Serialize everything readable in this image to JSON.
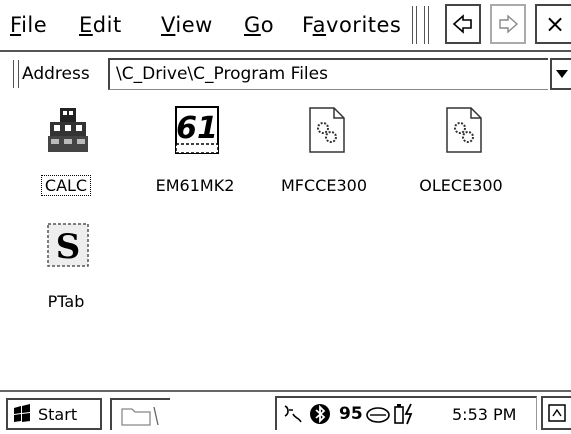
{
  "menubar": {
    "items": [
      {
        "label_pre": "",
        "label_u": "F",
        "label_post": "ile"
      },
      {
        "label_pre": "",
        "label_u": "E",
        "label_post": "dit"
      },
      {
        "label_pre": "",
        "label_u": "V",
        "label_post": "iew"
      },
      {
        "label_pre": "",
        "label_u": "G",
        "label_post": "o"
      },
      {
        "label_pre": "F",
        "label_u": "a",
        "label_post": "vorites"
      }
    ],
    "back_icon": "back-arrow-icon",
    "forward_icon": "forward-arrow-icon",
    "close_label": "×"
  },
  "address": {
    "label": "Address",
    "value": "\\C_Drive\\C_Program Files"
  },
  "files": [
    {
      "name": "CALC",
      "icon": "calc-app-icon",
      "selected": true
    },
    {
      "name": "EM61MK2",
      "icon": "em61-app-icon",
      "selected": false
    },
    {
      "name": "MFCCE300",
      "icon": "dll-gears-icon",
      "selected": false
    },
    {
      "name": "OLECE300",
      "icon": "dll-gears-icon",
      "selected": false
    },
    {
      "name": "PTab",
      "icon": "ptab-app-icon",
      "selected": false
    }
  ],
  "icon_glyphs": {
    "em61": "61",
    "ptab": "S"
  },
  "taskbar": {
    "start_label": "Start",
    "clock": "5:53 PM",
    "tray_bluetooth": "ʙ",
    "tray_volume": "95"
  }
}
